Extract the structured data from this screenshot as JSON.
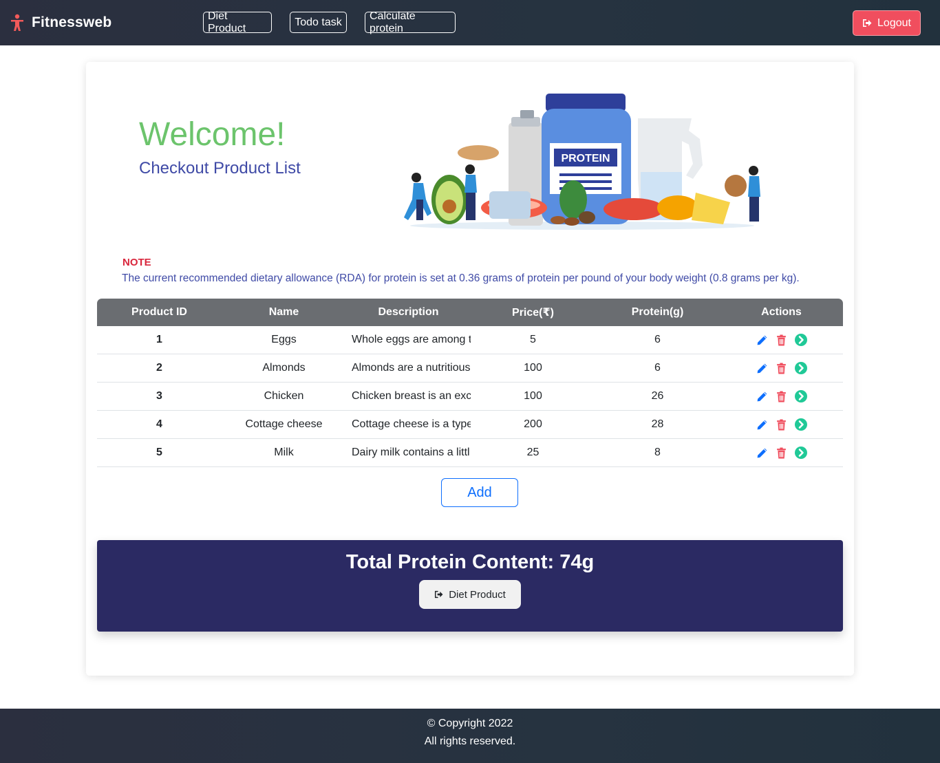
{
  "navbar": {
    "brand": "Fitnessweb",
    "links": [
      "Diet Product",
      "Todo task",
      "Calculate protein"
    ],
    "logout_label": "Logout"
  },
  "hero": {
    "welcome": "Welcome!",
    "subtitle": "Checkout Product List",
    "image_label": "PROTEIN"
  },
  "note": {
    "title": "NOTE",
    "text": "The current recommended dietary allowance (RDA) for protein is set at 0.36 grams of protein per pound of your body weight (0.8 grams per kg)."
  },
  "table": {
    "headers": [
      "Product ID",
      "Name",
      "Description",
      "Price(₹)",
      "Protein(g)",
      "Actions"
    ],
    "rows": [
      {
        "id": "1",
        "name": "Eggs",
        "description": "Whole eggs are among t",
        "price": "5",
        "protein": "6"
      },
      {
        "id": "2",
        "name": "Almonds",
        "description": "Almonds are a nutritious",
        "price": "100",
        "protein": "6"
      },
      {
        "id": "3",
        "name": "Chicken",
        "description": "Chicken breast is an exc",
        "price": "100",
        "protein": "26"
      },
      {
        "id": "4",
        "name": "Cottage cheese",
        "description": "Cottage cheese is a type",
        "price": "200",
        "protein": "28"
      },
      {
        "id": "5",
        "name": "Milk",
        "description": "Dairy milk contains a littl",
        "price": "25",
        "protein": "8"
      }
    ],
    "action_icons": [
      "pencil-icon",
      "trash-icon",
      "arrow-circle-right-icon"
    ]
  },
  "add_label": "Add",
  "total": {
    "text": "Total Protein Content: 74g",
    "button_label": "Diet Product"
  },
  "footer": {
    "line1": "© Copyright 2022",
    "line2": "All rights reserved."
  },
  "colors": {
    "nav_bg": "#2b2f3f",
    "logout": "#f04e5e",
    "welcome": "#6cc46c",
    "subtitle": "#3f4aa6",
    "note_title": "#d9263c",
    "table_header": "#6a6d71",
    "total_bg": "#2b2a63",
    "edit_icon": "#0d6efd",
    "delete_icon": "#f04e5e",
    "go_icon": "#20c997"
  }
}
